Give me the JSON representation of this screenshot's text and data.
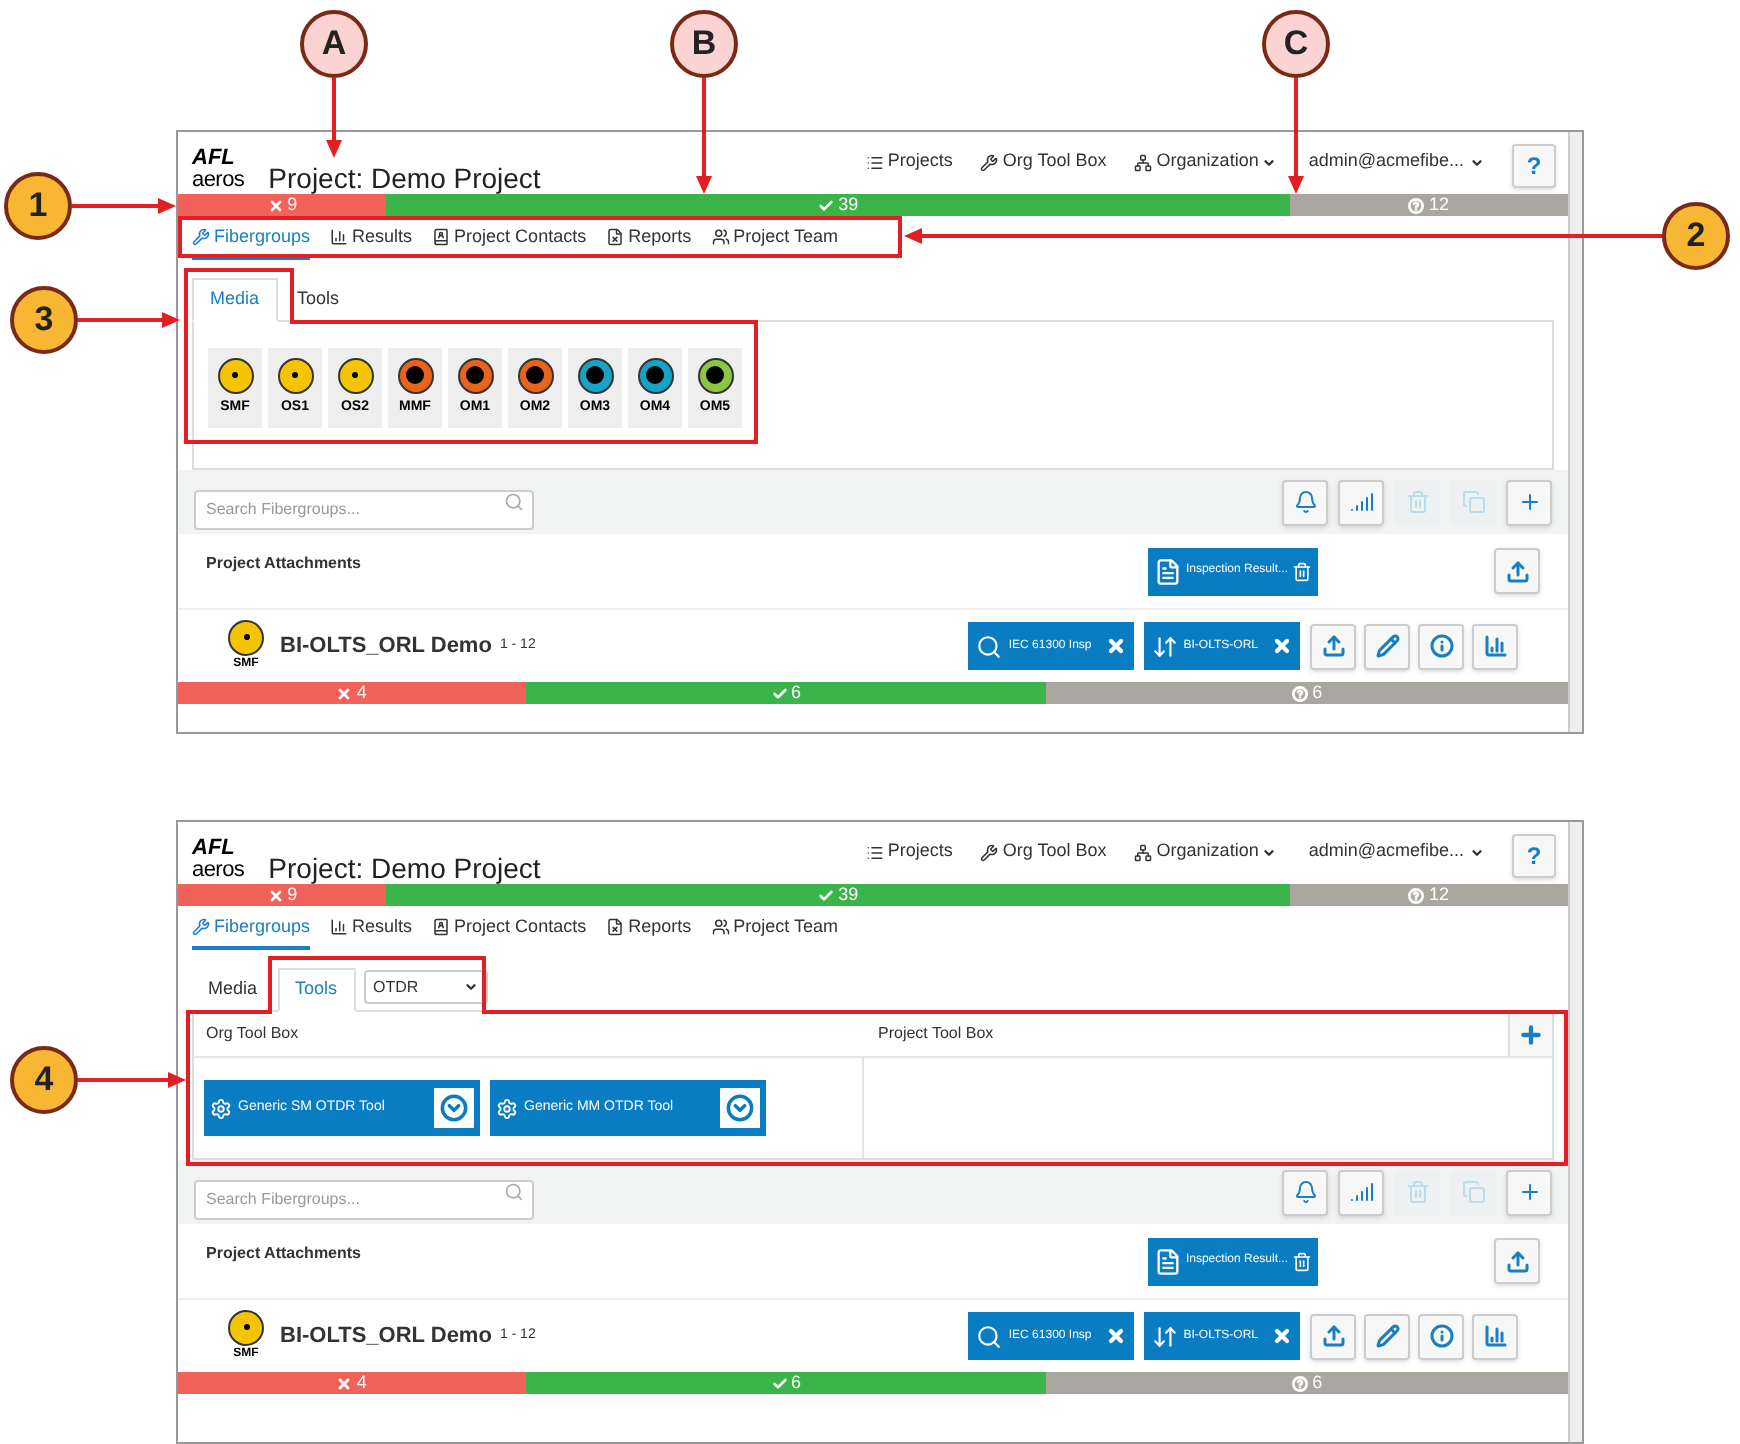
{
  "callouts": [
    {
      "label": "A",
      "kind": "letter"
    },
    {
      "label": "B",
      "kind": "letter"
    },
    {
      "label": "C",
      "kind": "letter"
    },
    {
      "label": "1",
      "kind": "number"
    },
    {
      "label": "2",
      "kind": "number"
    },
    {
      "label": "3",
      "kind": "number"
    },
    {
      "label": "4",
      "kind": "number"
    }
  ],
  "screens": [
    {
      "logo": {
        "brand": "AFL",
        "product": "aeros"
      },
      "title": "Project: Demo Project",
      "nav": [
        {
          "label": "Projects",
          "dropdown": false
        },
        {
          "label": "Org Tool Box",
          "dropdown": false
        },
        {
          "label": "Organization",
          "dropdown": true
        }
      ],
      "user": {
        "label": "admin@acmefibe...",
        "dropdown": true
      },
      "help": "?",
      "status": [
        {
          "kind": "fail",
          "count": "9"
        },
        {
          "kind": "pass",
          "count": "39"
        },
        {
          "kind": "unknown",
          "count": "12"
        }
      ],
      "tabs": [
        {
          "label": "Fibergroups",
          "selected": true
        },
        {
          "label": "Results",
          "selected": false
        },
        {
          "label": "Project Contacts",
          "selected": false
        },
        {
          "label": "Reports",
          "selected": false
        },
        {
          "label": "Project Team",
          "selected": false
        }
      ],
      "subtabs": [
        {
          "label": "Media",
          "selected": true
        },
        {
          "label": "Tools",
          "selected": false
        }
      ],
      "panel": {
        "kind": "media",
        "items": [
          {
            "label": "SMF",
            "kind": "singlemode",
            "color": "#f5c400"
          },
          {
            "label": "OS1",
            "kind": "singlemode",
            "color": "#f5c400"
          },
          {
            "label": "OS2",
            "kind": "singlemode",
            "color": "#f5c400"
          },
          {
            "label": "MMF",
            "kind": "multimode",
            "color": "#e8641b"
          },
          {
            "label": "OM1",
            "kind": "multimode",
            "color": "#e8641b"
          },
          {
            "label": "OM2",
            "kind": "multimode",
            "color": "#e8641b"
          },
          {
            "label": "OM3",
            "kind": "multimode",
            "color": "#17a2c8"
          },
          {
            "label": "OM4",
            "kind": "multimode",
            "color": "#17a2c8"
          },
          {
            "label": "OM5",
            "kind": "multimode",
            "color": "#8dc63f"
          }
        ]
      },
      "search": {
        "placeholder": "Search Fibergroups..."
      },
      "toolbar": [
        {
          "disabled": false
        },
        {
          "disabled": false
        },
        {
          "disabled": true
        },
        {
          "disabled": true
        },
        {
          "disabled": false
        }
      ],
      "attachments": {
        "title": "Project Attachments",
        "files": [
          "Inspection Result..."
        ]
      },
      "fibergroups": [
        {
          "media": {
            "label": "SMF",
            "color": "#f5c400"
          },
          "name": "BI-OLTS_ORL Demo",
          "range": "1 - 12",
          "tests": [
            "IEC 61300 Insp",
            "BI-OLTS-ORL"
          ],
          "status": [
            {
              "kind": "fail",
              "count": "4"
            },
            {
              "kind": "pass",
              "count": "6"
            },
            {
              "kind": "unknown",
              "count": "6"
            }
          ]
        }
      ]
    },
    {
      "logo": {
        "brand": "AFL",
        "product": "aeros"
      },
      "title": "Project: Demo Project",
      "nav": [
        {
          "label": "Projects",
          "dropdown": false
        },
        {
          "label": "Org Tool Box",
          "dropdown": false
        },
        {
          "label": "Organization",
          "dropdown": true
        }
      ],
      "user": {
        "label": "admin@acmefibe...",
        "dropdown": true
      },
      "help": "?",
      "status": [
        {
          "kind": "fail",
          "count": "9"
        },
        {
          "kind": "pass",
          "count": "39"
        },
        {
          "kind": "unknown",
          "count": "12"
        }
      ],
      "tabs": [
        {
          "label": "Fibergroups",
          "selected": true
        },
        {
          "label": "Results",
          "selected": false
        },
        {
          "label": "Project Contacts",
          "selected": false
        },
        {
          "label": "Reports",
          "selected": false
        },
        {
          "label": "Project Team",
          "selected": false
        }
      ],
      "subtabs": [
        {
          "label": "Media",
          "selected": false
        },
        {
          "label": "Tools",
          "selected": true
        }
      ],
      "panel": {
        "kind": "tools",
        "filter": "OTDR",
        "org_title": "Org Tool Box",
        "project_title": "Project Tool Box",
        "tools": [
          "Generic SM OTDR Tool",
          "Generic MM OTDR Tool"
        ]
      },
      "search": {
        "placeholder": "Search Fibergroups..."
      },
      "toolbar": [
        {
          "disabled": false
        },
        {
          "disabled": false
        },
        {
          "disabled": true
        },
        {
          "disabled": true
        },
        {
          "disabled": false
        }
      ],
      "attachments": {
        "title": "Project Attachments",
        "files": [
          "Inspection Result..."
        ]
      },
      "fibergroups": [
        {
          "media": {
            "label": "SMF",
            "color": "#f5c400"
          },
          "name": "BI-OLTS_ORL Demo",
          "range": "1 - 12",
          "tests": [
            "IEC 61300 Insp",
            "BI-OLTS-ORL"
          ],
          "status": [
            {
              "kind": "fail",
              "count": "4"
            },
            {
              "kind": "pass",
              "count": "6"
            },
            {
              "kind": "unknown",
              "count": "6"
            }
          ]
        }
      ]
    }
  ]
}
